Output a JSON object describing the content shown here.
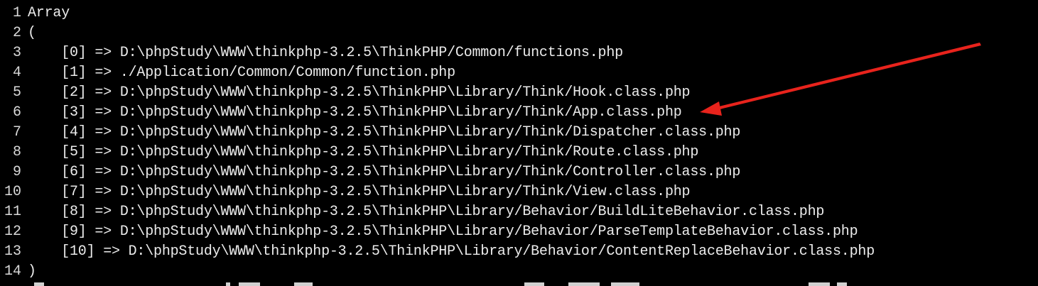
{
  "output": {
    "lines": [
      {
        "num": "1",
        "text": "Array"
      },
      {
        "num": "2",
        "text": "("
      },
      {
        "num": "3",
        "text": "    [0] => D:\\phpStudy\\WWW\\thinkphp-3.2.5\\ThinkPHP/Common/functions.php"
      },
      {
        "num": "4",
        "text": "    [1] => ./Application/Common/Common/function.php"
      },
      {
        "num": "5",
        "text": "    [2] => D:\\phpStudy\\WWW\\thinkphp-3.2.5\\ThinkPHP\\Library/Think/Hook.class.php"
      },
      {
        "num": "6",
        "text": "    [3] => D:\\phpStudy\\WWW\\thinkphp-3.2.5\\ThinkPHP\\Library/Think/App.class.php"
      },
      {
        "num": "7",
        "text": "    [4] => D:\\phpStudy\\WWW\\thinkphp-3.2.5\\ThinkPHP\\Library/Think/Dispatcher.class.php"
      },
      {
        "num": "8",
        "text": "    [5] => D:\\phpStudy\\WWW\\thinkphp-3.2.5\\ThinkPHP\\Library/Think/Route.class.php"
      },
      {
        "num": "9",
        "text": "    [6] => D:\\phpStudy\\WWW\\thinkphp-3.2.5\\ThinkPHP\\Library/Think/Controller.class.php"
      },
      {
        "num": "10",
        "text": "    [7] => D:\\phpStudy\\WWW\\thinkphp-3.2.5\\ThinkPHP\\Library/Think/View.class.php"
      },
      {
        "num": "11",
        "text": "    [8] => D:\\phpStudy\\WWW\\thinkphp-3.2.5\\ThinkPHP\\Library/Behavior/BuildLiteBehavior.class.php"
      },
      {
        "num": "12",
        "text": "    [9] => D:\\phpStudy\\WWW\\thinkphp-3.2.5\\ThinkPHP\\Library/Behavior/ParseTemplateBehavior.class.php"
      },
      {
        "num": "13",
        "text": "    [10] => D:\\phpStudy\\WWW\\thinkphp-3.2.5\\ThinkPHP\\Library/Behavior/ContentReplaceBehavior.class.php"
      },
      {
        "num": "14",
        "text": ")"
      }
    ]
  },
  "annotation": {
    "color": "#e8231c",
    "icon": "arrow-icon"
  },
  "colors": {
    "background": "#000000",
    "text": "#ececec"
  }
}
